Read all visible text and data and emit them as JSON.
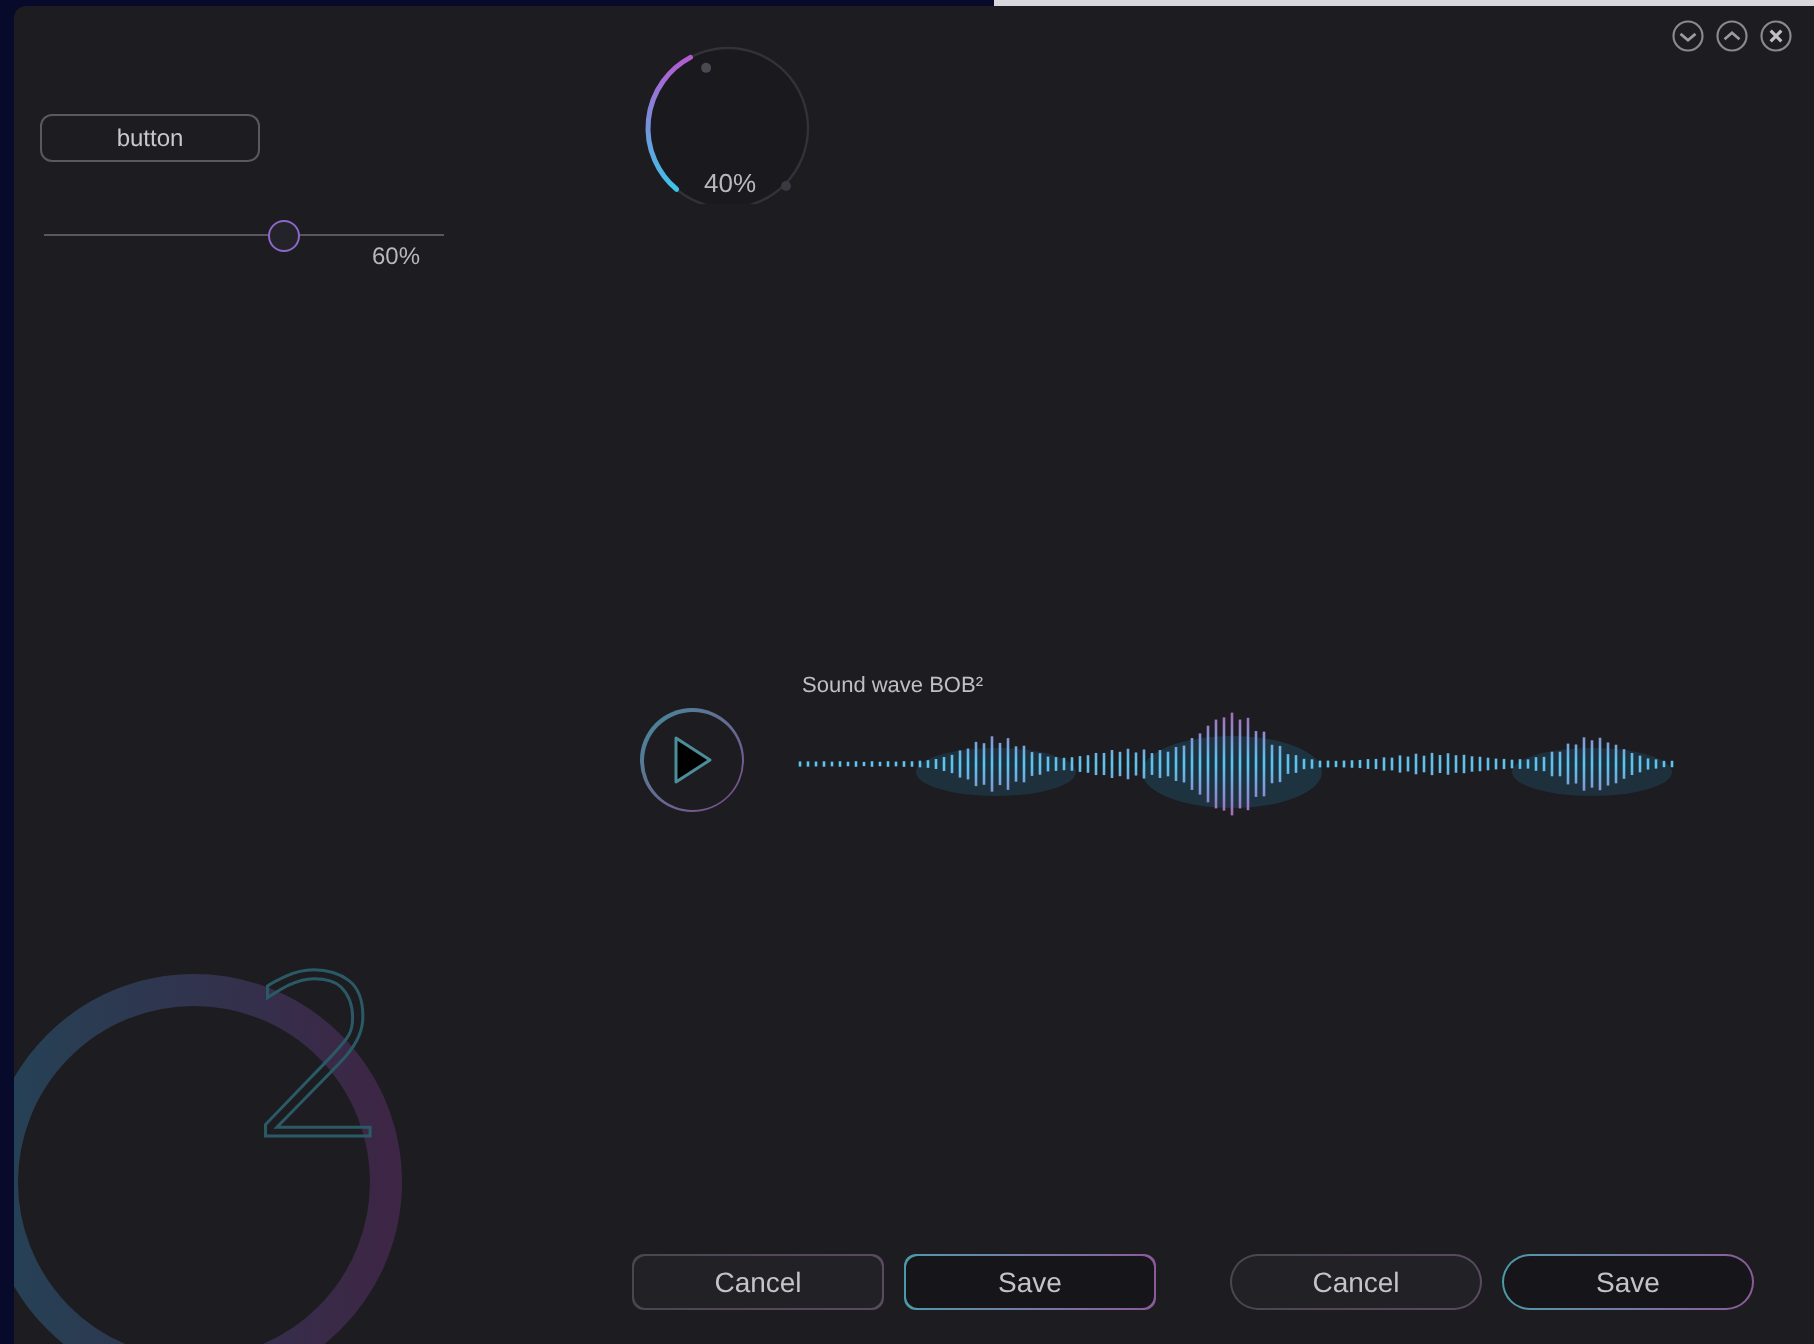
{
  "window_controls": [
    {
      "kind": "collapse"
    },
    {
      "kind": "expand"
    },
    {
      "kind": "close"
    }
  ],
  "button": {
    "label": "button"
  },
  "slider": {
    "level": 0.6,
    "reading": "60%"
  },
  "knob": {
    "reading": "40%"
  },
  "player": {
    "title": "Sound wave BOB²"
  },
  "logo": {
    "text": "2"
  },
  "button_groups": [
    {
      "kind": "rounded",
      "buttons": [
        {
          "label": "Cancel",
          "kind": "secondary"
        },
        {
          "label": "Save",
          "kind": "primary"
        }
      ]
    },
    {
      "kind": "pill",
      "buttons": [
        {
          "label": "Cancel",
          "kind": "secondary"
        },
        {
          "label": "Save",
          "kind": "primary"
        }
      ]
    }
  ]
}
